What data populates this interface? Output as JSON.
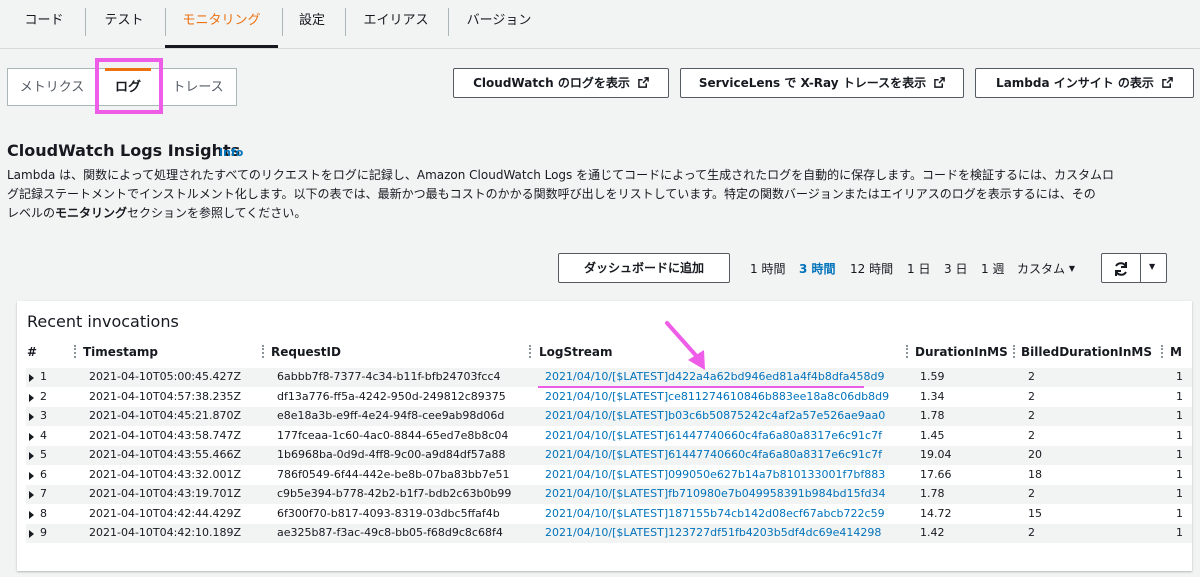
{
  "top_tabs": [
    "コード",
    "テスト",
    "モニタリング",
    "設定",
    "エイリアス",
    "バージョン"
  ],
  "sub_tabs": [
    "メトリクス",
    "ログ",
    "トレース"
  ],
  "action_buttons": [
    "CloudWatch のログを表示",
    "ServiceLens で X-Ray トレースを表示",
    "Lambda インサイト の表示"
  ],
  "section": {
    "title": "CloudWatch Logs Insights",
    "info": "Info",
    "desc_1": "Lambda は、関数によって処理されたすべてのリクエストをログに記録し、Amazon CloudWatch Logs を通じてコードによって生成されたログを自動的に保存します。コードを検証するには、カスタムロ",
    "desc_2": "グ記録ステートメントでインストルメント化します。以下の表では、最新かつ最もコストのかかる関数呼び出しをリストしています。特定の関数バージョンまたはエイリアスのログを表示するには、その",
    "desc_3a": "レベルの",
    "desc_3b": "モニタリング",
    "desc_3c": "セクションを参照してください。"
  },
  "toolbar": {
    "dashboard_button": "ダッシュボードに追加",
    "ranges": [
      "1 時間",
      "3 時間",
      "12 時間",
      "1 日",
      "3 日",
      "1 週"
    ],
    "selected_range": "3 時間",
    "custom": "カスタム"
  },
  "table": {
    "title": "Recent invocations",
    "headers": [
      "#",
      "Timestamp",
      "RequestID",
      "LogStream",
      "DurationInMS",
      "BilledDurationInMS",
      "M"
    ],
    "rows": [
      [
        "1",
        "2021-04-10T05:00:45.427Z",
        "6abbb7f8-7377-4c34-b11f-bfb24703fcc4",
        "2021/04/10/[$LATEST]d422a4a62bd946ed81a4f4b8dfa458d9",
        "1.59",
        "2",
        "1"
      ],
      [
        "2",
        "2021-04-10T04:57:38.235Z",
        "df13a776-ff5a-4242-950d-249812c89375",
        "2021/04/10/[$LATEST]ce811274610846b883ee18a8c06db8d9",
        "1.34",
        "2",
        "1"
      ],
      [
        "3",
        "2021-04-10T04:45:21.870Z",
        "e8e18a3b-e9ff-4e24-94f8-cee9ab98d06d",
        "2021/04/10/[$LATEST]b03c6b50875242c4af2a57e526ae9aa0",
        "1.78",
        "2",
        "1"
      ],
      [
        "4",
        "2021-04-10T04:43:58.747Z",
        "177fceaa-1c60-4ac0-8844-65ed7e8b8c04",
        "2021/04/10/[$LATEST]61447740660c4fa6a80a8317e6c91c7f",
        "1.45",
        "2",
        "1"
      ],
      [
        "5",
        "2021-04-10T04:43:55.466Z",
        "1b6968ba-0d9d-4ff8-9c00-a9d84df57a88",
        "2021/04/10/[$LATEST]61447740660c4fa6a80a8317e6c91c7f",
        "19.04",
        "20",
        "1"
      ],
      [
        "6",
        "2021-04-10T04:43:32.001Z",
        "786f0549-6f44-442e-be8b-07ba83bb7e51",
        "2021/04/10/[$LATEST]099050e627b14a7b810133001f7bf883",
        "17.66",
        "18",
        "1"
      ],
      [
        "7",
        "2021-04-10T04:43:19.701Z",
        "c9b5e394-b778-42b2-b1f7-bdb2c63b0b99",
        "2021/04/10/[$LATEST]fb710980e7b049958391b984bd15fd34",
        "1.78",
        "2",
        "1"
      ],
      [
        "8",
        "2021-04-10T04:42:44.429Z",
        "6f300f70-b817-4093-8319-03dbc5ffaf4b",
        "2021/04/10/[$LATEST]187155b74cb142d08ecf67abcb722c59",
        "14.72",
        "15",
        "1"
      ],
      [
        "9",
        "2021-04-10T04:42:10.189Z",
        "ae325b87-f3ac-49c8-bb05-f68d9c8c68f4",
        "2021/04/10/[$LATEST]123727df51fb4203b5df4dc69e414298",
        "1.42",
        "2",
        "1"
      ]
    ]
  },
  "colors": {
    "accent": "#ec7211",
    "link": "#0073bb",
    "annotation": "#ee5de8"
  }
}
